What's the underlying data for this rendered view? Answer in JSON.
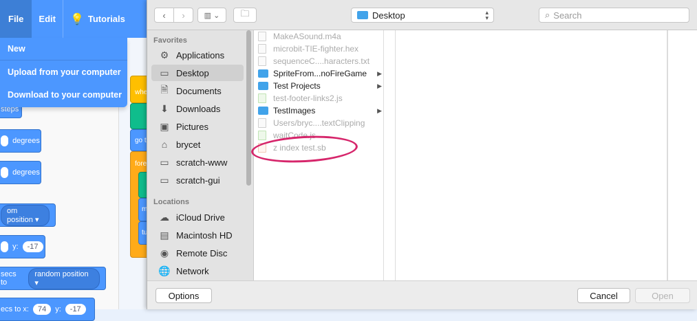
{
  "scratch": {
    "menu": {
      "file": "File",
      "edit": "Edit",
      "tutorials": "Tutorials"
    },
    "file_menu": [
      "New",
      "Upload from your computer",
      "Download to your computer"
    ],
    "blocks": {
      "steps": "steps",
      "degrees1": "degrees",
      "degrees2": "degrees",
      "position_dropdown": "om position",
      "y_label": "y:",
      "y_value": "-17",
      "secs_to": "secs to",
      "random_position": "random position",
      "bottom_partial": "ecs to x:",
      "bottom_x": "74",
      "bottom_y_label": "y:",
      "bottom_y": "-17",
      "script_when": "whe",
      "script_go": "go t",
      "script_forever": "fore",
      "script_m": "m",
      "script_tu": "tu"
    }
  },
  "dialog": {
    "location": "Desktop",
    "search_placeholder": "Search",
    "favorites_header": "Favorites",
    "locations_header": "Locations",
    "favorites": [
      {
        "label": "Applications",
        "icon": "applications-icon"
      },
      {
        "label": "Desktop",
        "icon": "desktop-icon",
        "selected": true
      },
      {
        "label": "Documents",
        "icon": "documents-icon"
      },
      {
        "label": "Downloads",
        "icon": "downloads-icon"
      },
      {
        "label": "Pictures",
        "icon": "pictures-icon"
      },
      {
        "label": "brycet",
        "icon": "home-icon"
      },
      {
        "label": "scratch-www",
        "icon": "folder-icon"
      },
      {
        "label": "scratch-gui",
        "icon": "folder-icon"
      }
    ],
    "locations": [
      {
        "label": "iCloud Drive",
        "icon": "cloud-icon"
      },
      {
        "label": "Macintosh HD",
        "icon": "disk-icon"
      },
      {
        "label": "Remote Disc",
        "icon": "disc-icon"
      },
      {
        "label": "Network",
        "icon": "network-icon"
      }
    ],
    "files": [
      {
        "name": "MakeASound.m4a",
        "type": "file",
        "enabled": false
      },
      {
        "name": "microbit-TIE-fighter.hex",
        "type": "file",
        "enabled": false
      },
      {
        "name": "sequenceC....haracters.txt",
        "type": "file",
        "enabled": false
      },
      {
        "name": "SpriteFrom...noFireGame",
        "type": "folder",
        "enabled": true
      },
      {
        "name": "Test Projects",
        "type": "folder",
        "enabled": true
      },
      {
        "name": "test-footer-links2.js",
        "type": "js",
        "enabled": false
      },
      {
        "name": "TestImages",
        "type": "folder",
        "enabled": true
      },
      {
        "name": "Users/bryc....textClipping",
        "type": "file",
        "enabled": false
      },
      {
        "name": "waitCode.js",
        "type": "js",
        "enabled": false
      },
      {
        "name": "z index test.sb",
        "type": "sb",
        "enabled": false
      }
    ],
    "buttons": {
      "options": "Options",
      "cancel": "Cancel",
      "open": "Open"
    },
    "highlight_color": "#d6266b"
  }
}
